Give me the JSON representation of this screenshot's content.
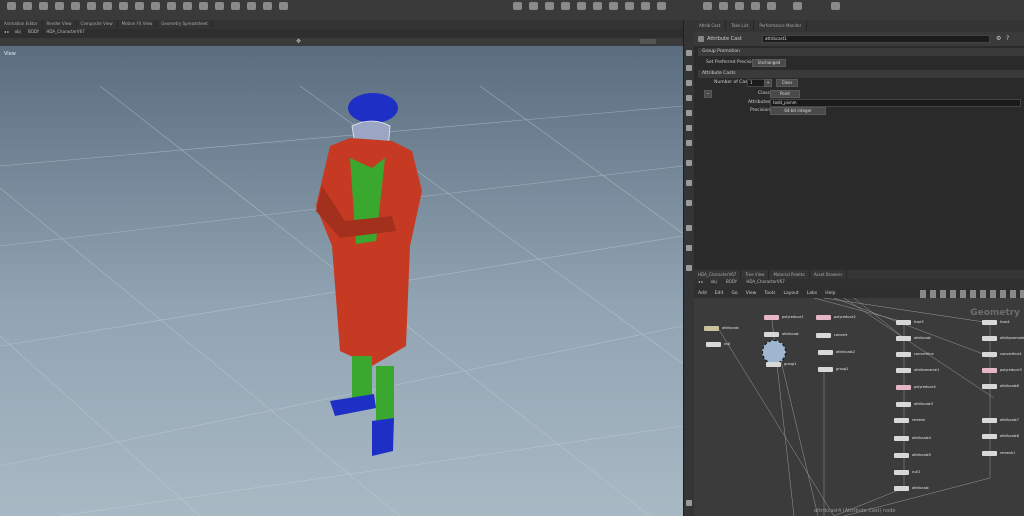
{
  "desktop_tabs": [
    "Animation Editor",
    "Render View",
    "Composite View",
    "Motion FX View",
    "Geometry Spreadsheet"
  ],
  "viewport": {
    "path_obj": "obj",
    "path_body": "BODY",
    "path_network": "HDA_CharacterV67",
    "label": "View"
  },
  "params": {
    "panel_tabs": [
      "Attrib Cast",
      "Take List",
      "Performance Monitor"
    ],
    "node_type": "Attribute Cast",
    "node_name": "attribcast1",
    "group_label": "Group Promotion",
    "set_preferred_label": "Set Preferred Precision",
    "set_preferred_value": "Unchanged",
    "section_title": "Attribute Casts",
    "num_casts_label": "Number of Casts",
    "num_casts_value": "1",
    "clear_label": "Clear",
    "class_label": "Class",
    "class_value": "Point",
    "attributes_label": "Attributes",
    "attributes_value": "todd_pivnm",
    "precision_label": "Precision",
    "precision_value": "64-bit integer"
  },
  "network": {
    "tabs": [
      "HDA_CharacterV67",
      "Tree View",
      "Material Palette",
      "Asset Browser"
    ],
    "path_obj": "obj",
    "path_body": "BODY",
    "path_network": "HDA_CharacterV67",
    "menu": [
      "Add",
      "Edit",
      "Go",
      "View",
      "Tools",
      "Layout",
      "Labs",
      "Help"
    ],
    "watermark": "Geometry",
    "footer": "attribcast4 (Attribute Cast) node",
    "nodes": {
      "n1": "attribcast",
      "n2": "polyreduce1",
      "n3": "attribcast",
      "n4": "polyreduce2",
      "n5": "null",
      "n6": "convert",
      "n7": "attribcast",
      "n8": "group1",
      "n9": "attribcast2",
      "n10": "group2",
      "n11": "fuse3",
      "n12": "attribcast",
      "n13": "convertline",
      "n14": "attribrename1",
      "n15": "polyreduce4",
      "n16": "attribcast3",
      "n17": "remesh",
      "n18": "attribcast4",
      "n19": "attribcast5",
      "n20": "null1",
      "n21": "fuse4",
      "n22": "attribpromote1",
      "n23": "convertline1",
      "n24": "polyreduce3",
      "n25": "attribcast6",
      "n26": "attribcast7",
      "n27": "attribcast8",
      "n28": "remesh1"
    }
  }
}
